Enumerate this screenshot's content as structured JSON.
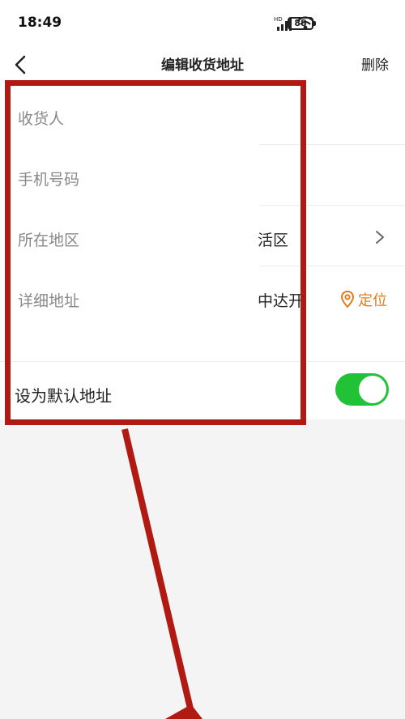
{
  "status_bar": {
    "time": "18:49",
    "battery": "88"
  },
  "nav": {
    "title": "编辑收货地址",
    "delete_label": "删除"
  },
  "form": {
    "recipient": {
      "label": "收货人"
    },
    "phone": {
      "label": "手机号码"
    },
    "region": {
      "label": "所在地区",
      "value": "活区"
    },
    "address": {
      "label": "详细地址",
      "value": "中达开",
      "locate_label": "定位"
    },
    "default": {
      "label": "设为默认地址",
      "enabled": true
    }
  },
  "colors": {
    "accent": "#e07b1a",
    "toggle_on": "#22c236",
    "annotation": "#b11a12"
  }
}
